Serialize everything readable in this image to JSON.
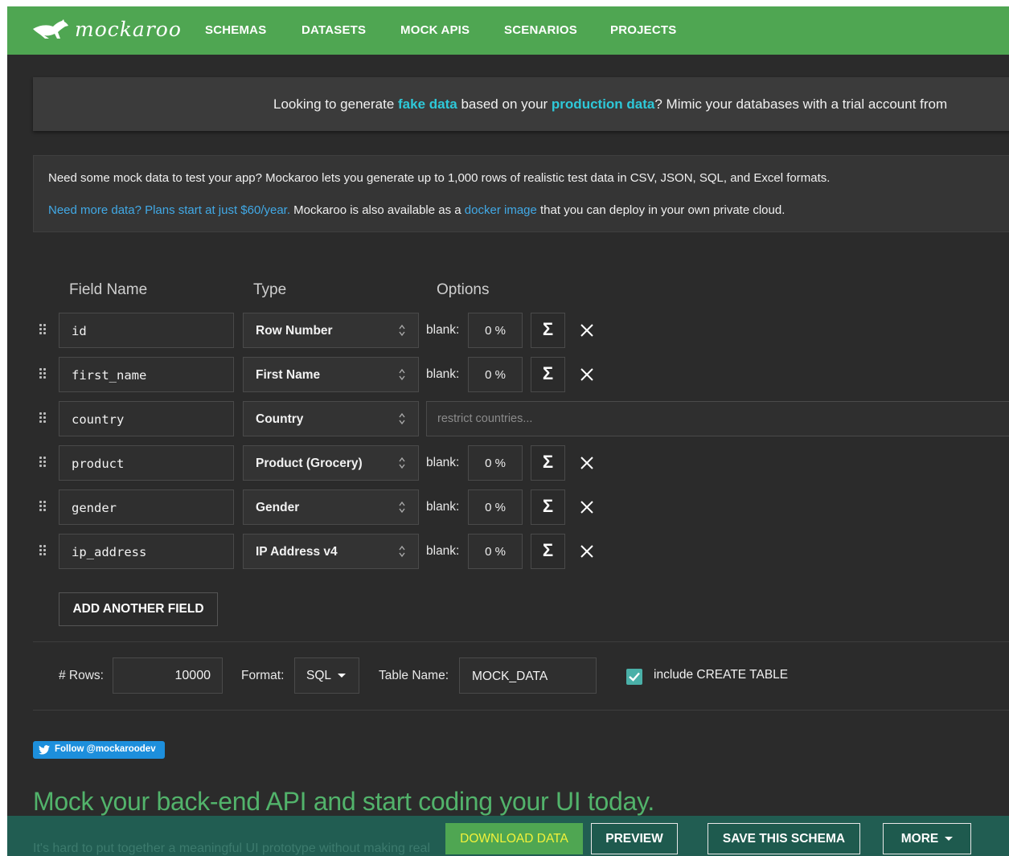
{
  "brand": {
    "name": "mockaroo",
    "logo_icon": "kangaroo-icon"
  },
  "nav": {
    "items": [
      {
        "label": "SCHEMAS"
      },
      {
        "label": "DATASETS"
      },
      {
        "label": "MOCK APIS"
      },
      {
        "label": "SCENARIOS"
      },
      {
        "label": "PROJECTS"
      }
    ]
  },
  "banner_promo": {
    "prefix": "Looking to generate ",
    "link1": "fake data",
    "middle": " based on your ",
    "link2": "production data",
    "suffix": "? Mimic your databases with a trial account from"
  },
  "banner_info": {
    "line1": "Need some mock data to test your app? Mockaroo lets you generate up to 1,000 rows of realistic test data in CSV, JSON, SQL, and Excel formats.",
    "plans_link": "Need more data? Plans start at just $60/year.",
    "line2_middle": " Mockaroo is also available as a ",
    "docker_link": "docker image",
    "line2_suffix": " that you can deploy in your own private cloud."
  },
  "columns": {
    "field_name": "Field Name",
    "type": "Type",
    "options": "Options"
  },
  "fields": [
    {
      "name": "id",
      "type": "Row Number",
      "blank_label": "blank:",
      "blank": "0 %",
      "sigma": "Σ"
    },
    {
      "name": "first_name",
      "type": "First Name",
      "blank_label": "blank:",
      "blank": "0 %",
      "sigma": "Σ"
    },
    {
      "name": "country",
      "type": "Country",
      "restrict_placeholder": "restrict countries..."
    },
    {
      "name": "product",
      "type": "Product (Grocery)",
      "blank_label": "blank:",
      "blank": "0 %",
      "sigma": "Σ"
    },
    {
      "name": "gender",
      "type": "Gender",
      "blank_label": "blank:",
      "blank": "0 %",
      "sigma": "Σ"
    },
    {
      "name": "ip_address",
      "type": "IP Address v4",
      "blank_label": "blank:",
      "blank": "0 %",
      "sigma": "Σ"
    }
  ],
  "add_field_label": "ADD ANOTHER FIELD",
  "options_bar": {
    "rows_label": "# Rows:",
    "rows_value": "10000",
    "format_label": "Format:",
    "format_value": "SQL",
    "table_name_label": "Table Name:",
    "table_name_value": "MOCK_DATA",
    "create_table_label": "include CREATE TABLE",
    "create_table_checked": true
  },
  "twitter": {
    "label": "Follow @mockaroodev"
  },
  "headline": "Mock your back-end API and start coding your UI today.",
  "bottom_bar": {
    "ghost_text": "It's hard to put together a meaningful UI prototype without making real",
    "download": "DOWNLOAD DATA",
    "preview": "PREVIEW",
    "save": "SAVE THIS SCHEMA",
    "more": "MORE"
  },
  "colors": {
    "nav_green": "#4fa652",
    "background": "#2b2b2b",
    "link_cyan": "#2ec8d8",
    "link_blue": "#41a9e6",
    "headline_green": "#52b36b",
    "bottom_bar": "#215d52",
    "download_text": "#f2f23a"
  }
}
